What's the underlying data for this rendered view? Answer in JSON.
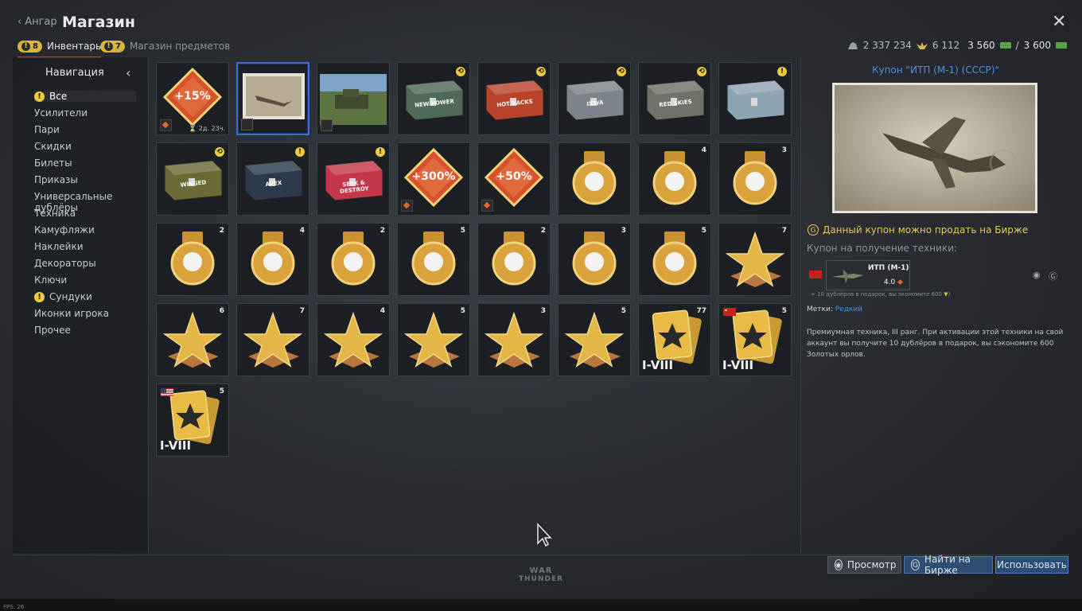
{
  "header": {
    "back_label": "Ангар",
    "title": "Магазин",
    "tabs": [
      {
        "badge": "8",
        "label": "Инвентарь"
      },
      {
        "badge": "7",
        "label": "Магазин предметов"
      }
    ],
    "currency": {
      "silver": "2 337 234",
      "gold": "6 112",
      "premium_current": "3 560",
      "premium_sep": "/",
      "premium_max": "3 600"
    }
  },
  "nav": {
    "title": "Навигация",
    "items": [
      {
        "label": "Все",
        "alert": true
      },
      {
        "label": "Усилители"
      },
      {
        "label": "Пари"
      },
      {
        "label": "Скидки"
      },
      {
        "label": "Билеты"
      },
      {
        "label": "Приказы"
      },
      {
        "label": "Универсальные дублёры"
      },
      {
        "label": "Техника"
      },
      {
        "label": "Камуфляжи"
      },
      {
        "label": "Наклейки"
      },
      {
        "label": "Декораторы"
      },
      {
        "label": "Ключи"
      },
      {
        "label": "Сундуки",
        "alert": true
      },
      {
        "label": "Иконки игрока"
      },
      {
        "label": "Прочее"
      }
    ]
  },
  "items": [
    {
      "type": "booster",
      "text": "+15%",
      "timer": "⌛ 2д. 23ч."
    },
    {
      "type": "coupon-photo",
      "selected": true
    },
    {
      "type": "vehicle-photo"
    },
    {
      "type": "chest",
      "color": "#4f6a57",
      "label": "NEW POWER",
      "count_icon": true
    },
    {
      "type": "chest",
      "color": "#b8452b",
      "label": "HOT RACKS",
      "count_icon": true
    },
    {
      "type": "chest",
      "color": "#7c838a",
      "label": "IXWA",
      "count_icon": true
    },
    {
      "type": "chest",
      "color": "#6d7368",
      "label": "RED SKIES",
      "count_icon": true
    },
    {
      "type": "chest",
      "color": "#8ea4b3",
      "label": "",
      "alert": true
    },
    {
      "type": "chest",
      "color": "#6b6a36",
      "label": "WINGED",
      "count_icon": true
    },
    {
      "type": "chest",
      "color": "#2c3a4c",
      "label": "APEX",
      "alert": true
    },
    {
      "type": "chest",
      "color": "#c4374a",
      "label": "SEEK & DESTROY",
      "alert": true
    },
    {
      "type": "booster",
      "text": "+300%"
    },
    {
      "type": "booster",
      "text": "+50%"
    },
    {
      "type": "medal",
      "count": ""
    },
    {
      "type": "medal",
      "count": "4"
    },
    {
      "type": "medal",
      "count": "3"
    },
    {
      "type": "medal",
      "count": "2"
    },
    {
      "type": "medal",
      "count": "4"
    },
    {
      "type": "medal",
      "count": "2"
    },
    {
      "type": "medal",
      "count": "5"
    },
    {
      "type": "medal",
      "count": "2"
    },
    {
      "type": "medal",
      "count": "3"
    },
    {
      "type": "medal",
      "count": "5"
    },
    {
      "type": "star",
      "count": "7"
    },
    {
      "type": "star",
      "count": "6"
    },
    {
      "type": "star",
      "count": "7"
    },
    {
      "type": "star",
      "count": "4"
    },
    {
      "type": "star",
      "count": "5"
    },
    {
      "type": "star",
      "count": "3"
    },
    {
      "type": "star",
      "count": "5"
    },
    {
      "type": "card",
      "count": "77",
      "rank": "I-VIII"
    },
    {
      "type": "card",
      "count": "5",
      "rank": "I-VIII",
      "flag": "ussr"
    },
    {
      "type": "card",
      "count": "5",
      "rank": "I-VIII",
      "flag": "usa"
    }
  ],
  "detail": {
    "title": "Купон \"ИТП (М-1) (СССР)\"",
    "sell_note": "Данный купон можно продать на Бирже",
    "coupon_label": "Купон на получение техники:",
    "vehicle_name": "ИТП (М-1)",
    "vehicle_br": "4.0",
    "bonus": "+ 10 дублёров в подарок, вы экономите 600",
    "tags_label": "Метки:",
    "tags_value": "Редкий",
    "description": "Премиумная техника, III ранг. При активации этой техники на свой аккаунт вы получите 10 дублёров в подарок, вы сэкономите 600 Золотых орлов."
  },
  "buttons": {
    "view": "Просмотр",
    "market": "Найти на Бирже",
    "use": "Использовать"
  },
  "logo": {
    "line1": "WAR",
    "line2": "THUNDER"
  },
  "fps": "FPS: 26",
  "colors": {
    "accent": "#4a8fe3",
    "gold": "#e8c65a",
    "tab_underline": "#c23b30"
  }
}
